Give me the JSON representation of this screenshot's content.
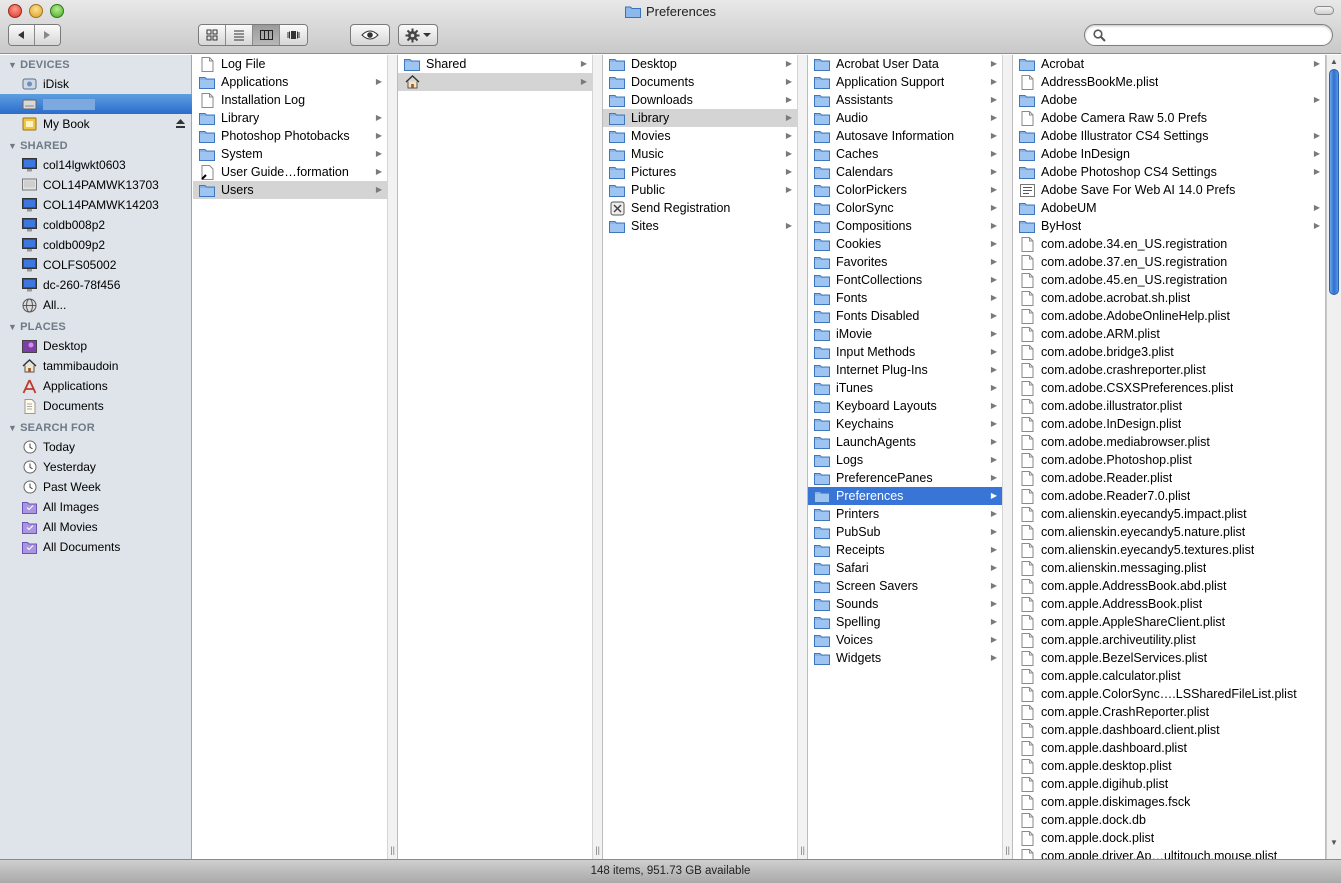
{
  "window": {
    "title": "Preferences",
    "status_text": "148 items, 951.73 GB available"
  },
  "toolbar": {
    "back_icon": "back-arrow-icon",
    "forward_icon": "forward-arrow-icon",
    "views": [
      "icon-view",
      "list-view",
      "column-view",
      "cover-flow-view"
    ],
    "selected_view": "column-view",
    "search_placeholder": "",
    "search_value": ""
  },
  "sidebar": {
    "devices_header": "DEVICES",
    "devices": [
      {
        "label": "iDisk",
        "icon": "idisk-icon"
      },
      {
        "label": "",
        "icon": "hard-disk-icon",
        "selected": true
      },
      {
        "label": "My Book",
        "icon": "external-drive-icon",
        "eject": true
      }
    ],
    "shared_header": "SHARED",
    "shared": [
      {
        "label": "col14lgwkt0603",
        "icon": "monitor-icon"
      },
      {
        "label": "COL14PAMWK13703",
        "icon": "pc-icon"
      },
      {
        "label": "COL14PAMWK14203",
        "icon": "monitor-icon"
      },
      {
        "label": "coldb008p2",
        "icon": "monitor-icon"
      },
      {
        "label": "coldb009p2",
        "icon": "monitor-icon"
      },
      {
        "label": "COLFS05002",
        "icon": "monitor-icon"
      },
      {
        "label": "dc-260-78f456",
        "icon": "monitor-icon"
      },
      {
        "label": "All...",
        "icon": "network-globe-icon"
      }
    ],
    "places_header": "PLACES",
    "places": [
      {
        "label": "Desktop",
        "icon": "desktop-icon"
      },
      {
        "label": "tammibaudoin",
        "icon": "home-icon"
      },
      {
        "label": "Applications",
        "icon": "applications-icon"
      },
      {
        "label": "Documents",
        "icon": "documents-icon"
      }
    ],
    "search_header": "SEARCH FOR",
    "searches": [
      {
        "label": "Today",
        "icon": "clock-icon"
      },
      {
        "label": "Yesterday",
        "icon": "clock-icon"
      },
      {
        "label": "Past Week",
        "icon": "clock-icon"
      },
      {
        "label": "All Images",
        "icon": "smart-folder-icon"
      },
      {
        "label": "All Movies",
        "icon": "smart-folder-icon"
      },
      {
        "label": "All Documents",
        "icon": "smart-folder-icon"
      }
    ]
  },
  "columns": [
    {
      "items": [
        {
          "label": "Log File",
          "icon": "document-icon",
          "arrow": false
        },
        {
          "label": "Applications",
          "icon": "folder-icon",
          "arrow": true
        },
        {
          "label": "Installation Log",
          "icon": "document-icon",
          "arrow": false
        },
        {
          "label": "Library",
          "icon": "folder-icon",
          "arrow": true
        },
        {
          "label": "Photoshop Photobacks",
          "icon": "folder-icon",
          "arrow": true
        },
        {
          "label": "System",
          "icon": "folder-icon",
          "arrow": true
        },
        {
          "label": "User Guide…formation",
          "icon": "alias-icon",
          "arrow": true
        },
        {
          "label": "Users",
          "icon": "folder-icon",
          "arrow": true,
          "state": "hl"
        }
      ]
    },
    {
      "items": [
        {
          "label": "Shared",
          "icon": "folder-icon",
          "arrow": true
        },
        {
          "label": "",
          "icon": "home-icon",
          "arrow": true,
          "state": "hl"
        }
      ]
    },
    {
      "items": [
        {
          "label": "Desktop",
          "icon": "folder-icon",
          "arrow": true
        },
        {
          "label": "Documents",
          "icon": "folder-icon",
          "arrow": true
        },
        {
          "label": "Downloads",
          "icon": "folder-icon",
          "arrow": true
        },
        {
          "label": "Library",
          "icon": "folder-icon",
          "arrow": true,
          "state": "hl"
        },
        {
          "label": "Movies",
          "icon": "folder-icon",
          "arrow": true
        },
        {
          "label": "Music",
          "icon": "folder-icon",
          "arrow": true
        },
        {
          "label": "Pictures",
          "icon": "folder-icon",
          "arrow": true
        },
        {
          "label": "Public",
          "icon": "folder-icon",
          "arrow": true
        },
        {
          "label": "Send Registration",
          "icon": "app-icon",
          "arrow": false
        },
        {
          "label": "Sites",
          "icon": "folder-icon",
          "arrow": true
        }
      ]
    },
    {
      "items": [
        {
          "label": "Acrobat User Data",
          "icon": "folder-icon",
          "arrow": true
        },
        {
          "label": "Application Support",
          "icon": "folder-icon",
          "arrow": true
        },
        {
          "label": "Assistants",
          "icon": "folder-icon",
          "arrow": true
        },
        {
          "label": "Audio",
          "icon": "folder-icon",
          "arrow": true
        },
        {
          "label": "Autosave Information",
          "icon": "folder-icon",
          "arrow": true
        },
        {
          "label": "Caches",
          "icon": "folder-icon",
          "arrow": true
        },
        {
          "label": "Calendars",
          "icon": "folder-icon",
          "arrow": true
        },
        {
          "label": "ColorPickers",
          "icon": "folder-icon",
          "arrow": true
        },
        {
          "label": "ColorSync",
          "icon": "folder-icon",
          "arrow": true
        },
        {
          "label": "Compositions",
          "icon": "folder-icon",
          "arrow": true
        },
        {
          "label": "Cookies",
          "icon": "folder-icon",
          "arrow": true
        },
        {
          "label": "Favorites",
          "icon": "folder-icon",
          "arrow": true
        },
        {
          "label": "FontCollections",
          "icon": "folder-icon",
          "arrow": true
        },
        {
          "label": "Fonts",
          "icon": "folder-icon",
          "arrow": true
        },
        {
          "label": "Fonts Disabled",
          "icon": "folder-icon",
          "arrow": true
        },
        {
          "label": "iMovie",
          "icon": "folder-icon",
          "arrow": true
        },
        {
          "label": "Input Methods",
          "icon": "folder-icon",
          "arrow": true
        },
        {
          "label": "Internet Plug-Ins",
          "icon": "folder-icon",
          "arrow": true
        },
        {
          "label": "iTunes",
          "icon": "folder-icon",
          "arrow": true
        },
        {
          "label": "Keyboard Layouts",
          "icon": "folder-icon",
          "arrow": true
        },
        {
          "label": "Keychains",
          "icon": "folder-icon",
          "arrow": true
        },
        {
          "label": "LaunchAgents",
          "icon": "folder-icon",
          "arrow": true
        },
        {
          "label": "Logs",
          "icon": "folder-icon",
          "arrow": true
        },
        {
          "label": "PreferencePanes",
          "icon": "folder-icon",
          "arrow": true
        },
        {
          "label": "Preferences",
          "icon": "folder-icon",
          "arrow": true,
          "state": "sel"
        },
        {
          "label": "Printers",
          "icon": "folder-icon",
          "arrow": true
        },
        {
          "label": "PubSub",
          "icon": "folder-icon",
          "arrow": true
        },
        {
          "label": "Receipts",
          "icon": "folder-icon",
          "arrow": true
        },
        {
          "label": "Safari",
          "icon": "folder-icon",
          "arrow": true
        },
        {
          "label": "Screen Savers",
          "icon": "folder-icon",
          "arrow": true
        },
        {
          "label": "Sounds",
          "icon": "folder-icon",
          "arrow": true
        },
        {
          "label": "Spelling",
          "icon": "folder-icon",
          "arrow": true
        },
        {
          "label": "Voices",
          "icon": "folder-icon",
          "arrow": true
        },
        {
          "label": "Widgets",
          "icon": "folder-icon",
          "arrow": true
        }
      ]
    },
    {
      "items": [
        {
          "label": "Acrobat",
          "icon": "folder-icon",
          "arrow": true
        },
        {
          "label": "AddressBookMe.plist",
          "icon": "document-icon",
          "arrow": false
        },
        {
          "label": "Adobe",
          "icon": "folder-icon",
          "arrow": true
        },
        {
          "label": "Adobe Camera Raw 5.0 Prefs",
          "icon": "document-icon",
          "arrow": false
        },
        {
          "label": "Adobe Illustrator CS4 Settings",
          "icon": "folder-icon",
          "arrow": true
        },
        {
          "label": "Adobe InDesign",
          "icon": "folder-icon",
          "arrow": true
        },
        {
          "label": "Adobe Photoshop CS4 Settings",
          "icon": "folder-icon",
          "arrow": true
        },
        {
          "label": "Adobe Save For Web AI 14.0 Prefs",
          "icon": "text-document-icon",
          "arrow": false
        },
        {
          "label": "AdobeUM",
          "icon": "folder-icon",
          "arrow": true
        },
        {
          "label": "ByHost",
          "icon": "folder-icon",
          "arrow": true
        },
        {
          "label": "com.adobe.34.en_US.registration",
          "icon": "document-icon",
          "arrow": false
        },
        {
          "label": "com.adobe.37.en_US.registration",
          "icon": "document-icon",
          "arrow": false
        },
        {
          "label": "com.adobe.45.en_US.registration",
          "icon": "document-icon",
          "arrow": false
        },
        {
          "label": "com.adobe.acrobat.sh.plist",
          "icon": "document-icon",
          "arrow": false
        },
        {
          "label": "com.adobe.AdobeOnlineHelp.plist",
          "icon": "document-icon",
          "arrow": false
        },
        {
          "label": "com.adobe.ARM.plist",
          "icon": "document-icon",
          "arrow": false
        },
        {
          "label": "com.adobe.bridge3.plist",
          "icon": "document-icon",
          "arrow": false
        },
        {
          "label": "com.adobe.crashreporter.plist",
          "icon": "document-icon",
          "arrow": false
        },
        {
          "label": "com.adobe.CSXSPreferences.plist",
          "icon": "document-icon",
          "arrow": false
        },
        {
          "label": "com.adobe.illustrator.plist",
          "icon": "document-icon",
          "arrow": false
        },
        {
          "label": "com.adobe.InDesign.plist",
          "icon": "document-icon",
          "arrow": false
        },
        {
          "label": "com.adobe.mediabrowser.plist",
          "icon": "document-icon",
          "arrow": false
        },
        {
          "label": "com.adobe.Photoshop.plist",
          "icon": "document-icon",
          "arrow": false
        },
        {
          "label": "com.adobe.Reader.plist",
          "icon": "document-icon",
          "arrow": false
        },
        {
          "label": "com.adobe.Reader7.0.plist",
          "icon": "document-icon",
          "arrow": false
        },
        {
          "label": "com.alienskin.eyecandy5.impact.plist",
          "icon": "document-icon",
          "arrow": false
        },
        {
          "label": "com.alienskin.eyecandy5.nature.plist",
          "icon": "document-icon",
          "arrow": false
        },
        {
          "label": "com.alienskin.eyecandy5.textures.plist",
          "icon": "document-icon",
          "arrow": false
        },
        {
          "label": "com.alienskin.messaging.plist",
          "icon": "document-icon",
          "arrow": false
        },
        {
          "label": "com.apple.AddressBook.abd.plist",
          "icon": "document-icon",
          "arrow": false
        },
        {
          "label": "com.apple.AddressBook.plist",
          "icon": "document-icon",
          "arrow": false
        },
        {
          "label": "com.apple.AppleShareClient.plist",
          "icon": "document-icon",
          "arrow": false
        },
        {
          "label": "com.apple.archiveutility.plist",
          "icon": "document-icon",
          "arrow": false
        },
        {
          "label": "com.apple.BezelServices.plist",
          "icon": "document-icon",
          "arrow": false
        },
        {
          "label": "com.apple.calculator.plist",
          "icon": "document-icon",
          "arrow": false
        },
        {
          "label": "com.apple.ColorSync….LSSharedFileList.plist",
          "icon": "document-icon",
          "arrow": false
        },
        {
          "label": "com.apple.CrashReporter.plist",
          "icon": "document-icon",
          "arrow": false
        },
        {
          "label": "com.apple.dashboard.client.plist",
          "icon": "document-icon",
          "arrow": false
        },
        {
          "label": "com.apple.dashboard.plist",
          "icon": "document-icon",
          "arrow": false
        },
        {
          "label": "com.apple.desktop.plist",
          "icon": "document-icon",
          "arrow": false
        },
        {
          "label": "com.apple.digihub.plist",
          "icon": "document-icon",
          "arrow": false
        },
        {
          "label": "com.apple.diskimages.fsck",
          "icon": "document-icon",
          "arrow": false
        },
        {
          "label": "com.apple.dock.db",
          "icon": "document-icon",
          "arrow": false
        },
        {
          "label": "com.apple.dock.plist",
          "icon": "document-icon",
          "arrow": false
        },
        {
          "label": "com.apple.driver.Ap…ultitouch.mouse.plist",
          "icon": "document-icon",
          "arrow": false
        }
      ]
    }
  ],
  "colors": {
    "selection": "#3875d7",
    "sidebar_bg": "#dee4ea",
    "folder": "#7faee8"
  }
}
